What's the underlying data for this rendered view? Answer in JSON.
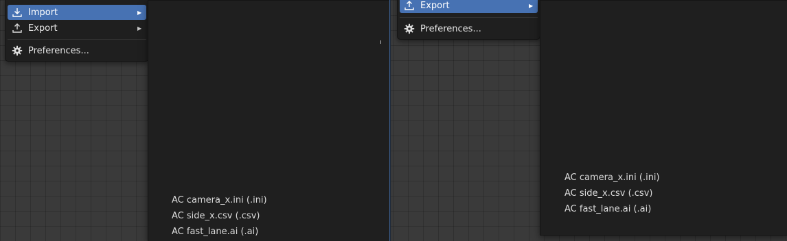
{
  "left": {
    "menu": {
      "import_label": "Import",
      "export_label": "Export",
      "preferences_label": "Preferences..."
    },
    "submenu": {
      "items": [
        "AC camera_x.ini (.ini)",
        "AC side_x.csv (.csv)",
        "AC fast_lane.ai (.ai)"
      ]
    }
  },
  "right": {
    "menu": {
      "export_label": "Export",
      "preferences_label": "Preferences..."
    },
    "submenu": {
      "items": [
        "AC camera_x.ini (.ini)",
        "AC side_x.csv (.csv)",
        "AC fast_lane.ai (.ai)"
      ]
    }
  },
  "icons": {
    "import": "import-icon",
    "export": "export-icon",
    "preferences": "gear-icon",
    "submenu_arrow": "triangle-right-icon"
  },
  "colors": {
    "active_highlight": "#4772b3",
    "menu_background": "#1f1f1f",
    "viewport_background": "#3a3a3a"
  }
}
